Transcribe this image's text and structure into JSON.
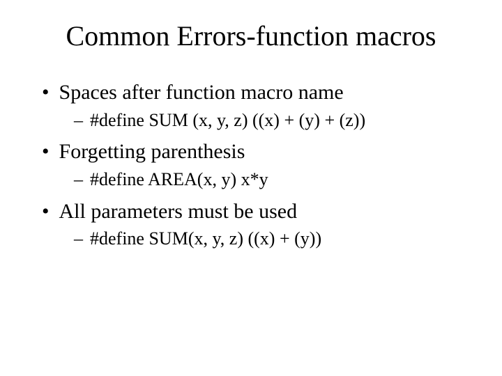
{
  "title": "Common Errors-function macros",
  "bullets": [
    {
      "text": "Spaces after function macro name",
      "sub": "#define SUM (x, y, z) ((x) + (y) + (z))"
    },
    {
      "text": "Forgetting parenthesis",
      "sub": "#define AREA(x, y) x*y"
    },
    {
      "text": "All parameters must be used",
      "sub": "#define SUM(x, y, z) ((x) + (y))"
    }
  ],
  "glyphs": {
    "dot": "•",
    "dash": "–"
  }
}
